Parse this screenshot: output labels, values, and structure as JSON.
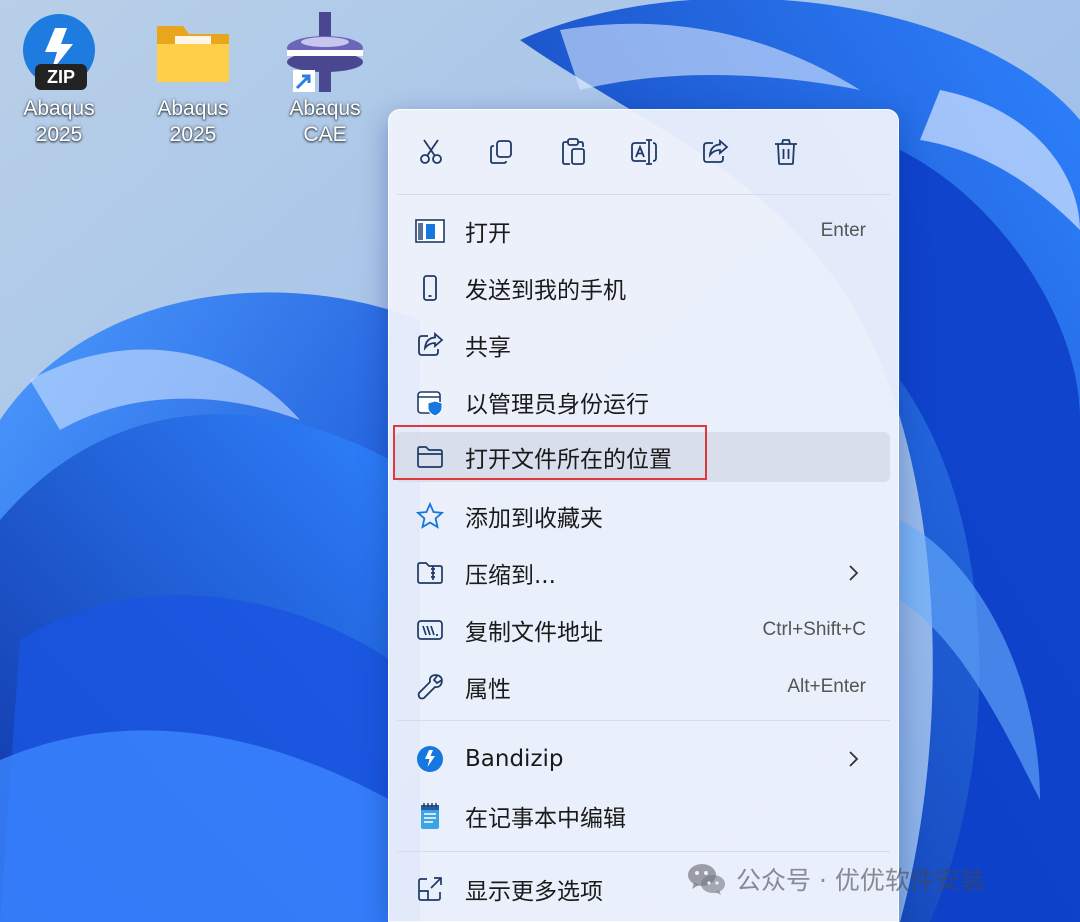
{
  "desktop": {
    "icons": [
      {
        "label": "Abaqus\n2025",
        "badge": "ZIP",
        "icon": "bandizip-archive-icon"
      },
      {
        "label": "Abaqus\n2025",
        "icon": "folder-icon"
      },
      {
        "label": "Abaqus CAE",
        "icon": "abaqus-cae-app-icon"
      }
    ]
  },
  "context_menu": {
    "toolbar": [
      {
        "icon": "cut-icon"
      },
      {
        "icon": "copy-icon"
      },
      {
        "icon": "paste-icon"
      },
      {
        "icon": "rename-icon"
      },
      {
        "icon": "share-icon"
      },
      {
        "icon": "delete-icon"
      }
    ],
    "items": [
      {
        "label": "打开",
        "shortcut": "Enter",
        "icon": "open-window-icon"
      },
      {
        "label": "发送到我的手机",
        "icon": "phone-icon"
      },
      {
        "label": "共享",
        "icon": "share-icon"
      },
      {
        "label": "以管理员身份运行",
        "icon": "admin-shield-icon"
      },
      {
        "label": "打开文件所在的位置",
        "icon": "folder-outline-icon",
        "highlighted": true
      },
      {
        "label": "添加到收藏夹",
        "icon": "star-icon"
      },
      {
        "label": "压缩到...",
        "icon": "zip-folder-icon",
        "has_submenu": true
      },
      {
        "label": "复制文件地址",
        "shortcut": "Ctrl+Shift+C",
        "icon": "copy-path-icon"
      },
      {
        "label": "属性",
        "shortcut": "Alt+Enter",
        "icon": "wrench-icon"
      },
      {
        "label": "Bandizip",
        "icon": "bandizip-icon",
        "has_submenu": true
      },
      {
        "label": "在记事本中编辑",
        "icon": "notepad-icon"
      },
      {
        "label": "显示更多选项",
        "icon": "more-options-icon"
      }
    ]
  },
  "watermark": {
    "text": "公众号 · 优优软件安装",
    "icon": "wechat-icon"
  },
  "colors": {
    "accent": "#0067c0",
    "highlight_frame": "#e0373b",
    "wallpaper_blue": "#1560e8"
  }
}
